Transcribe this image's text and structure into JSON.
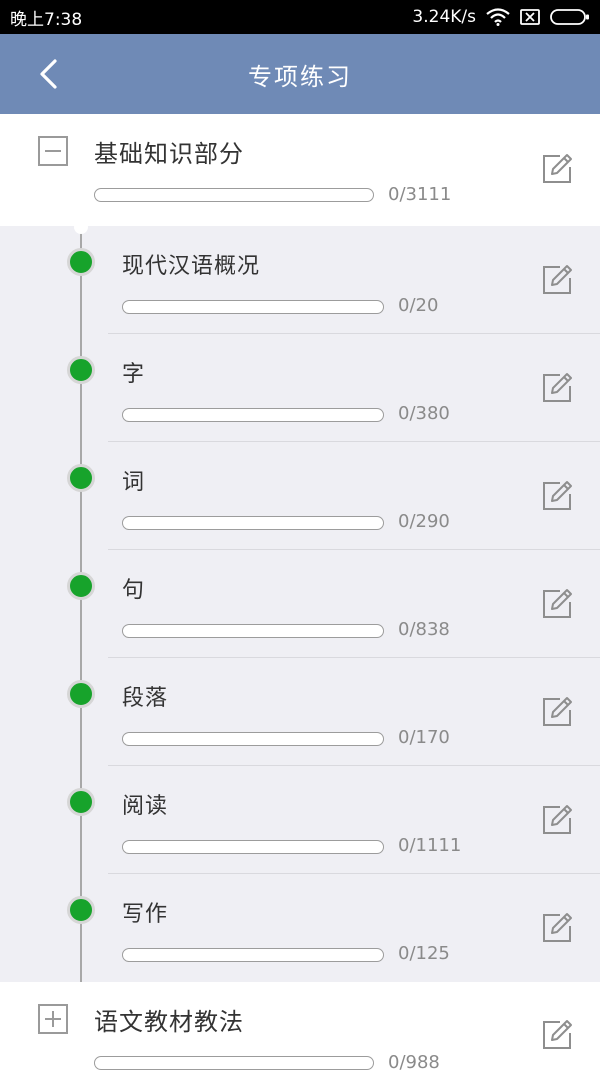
{
  "status_bar": {
    "time": "晚上7:38",
    "speed": "3.24K/s"
  },
  "header": {
    "title": "专项练习"
  },
  "groups": [
    {
      "title": "基础知识部分",
      "count": "0/3111",
      "progress": 0,
      "expanded": true,
      "items": [
        {
          "title": "现代汉语概况",
          "count": "0/20",
          "progress": 0
        },
        {
          "title": "字",
          "count": "0/380",
          "progress": 0
        },
        {
          "title": "词",
          "count": "0/290",
          "progress": 0
        },
        {
          "title": "句",
          "count": "0/838",
          "progress": 0
        },
        {
          "title": "段落",
          "count": "0/170",
          "progress": 0
        },
        {
          "title": "阅读",
          "count": "0/1111",
          "progress": 0
        },
        {
          "title": "写作",
          "count": "0/125",
          "progress": 0
        }
      ]
    },
    {
      "title": "语文教材教法",
      "count": "0/988",
      "progress": 0,
      "expanded": false
    }
  ],
  "colors": {
    "header": "#6f8ab6",
    "dot": "#17a32b",
    "background": "#efeff4"
  }
}
